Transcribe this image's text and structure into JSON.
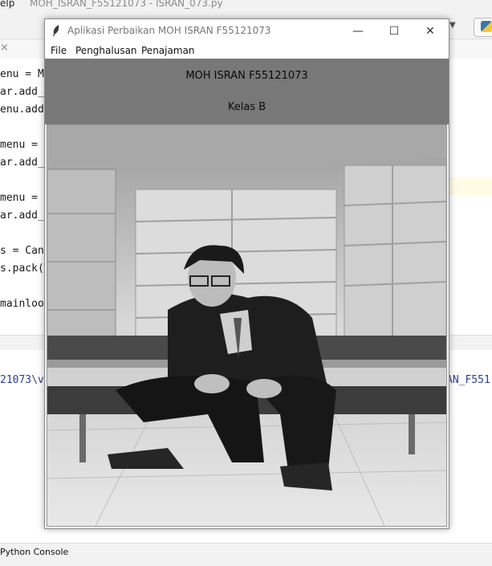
{
  "ide": {
    "menu_tail": "elp",
    "title": "MOH_ISRAN_F55121073 - ISRAN_073.py",
    "tab_close": "×",
    "code_lines": [
      "enu = Mo",
      "ar.add_",
      "enu.add_",
      "",
      "menu = M",
      "ar.add_",
      "",
      "menu = M",
      "ar.add_",
      "",
      "s = Canv",
      "s.pack(",
      "",
      "mainloop"
    ],
    "console_left": "21073\\v",
    "console_right": "AN_F551",
    "bottom_label": "Python Console"
  },
  "window": {
    "title": "Aplikasi Perbaikan MOH ISRAN F55121073",
    "menu": [
      "File",
      "Penghalusan",
      "Penajaman"
    ],
    "header_name": "MOH ISRAN F55121073",
    "header_class": "Kelas B",
    "controls": {
      "minimize": "—",
      "maximize": "☐",
      "close": "✕"
    }
  },
  "colors": {
    "header_bg": "#787878",
    "window_bg": "#f0f0f0"
  }
}
